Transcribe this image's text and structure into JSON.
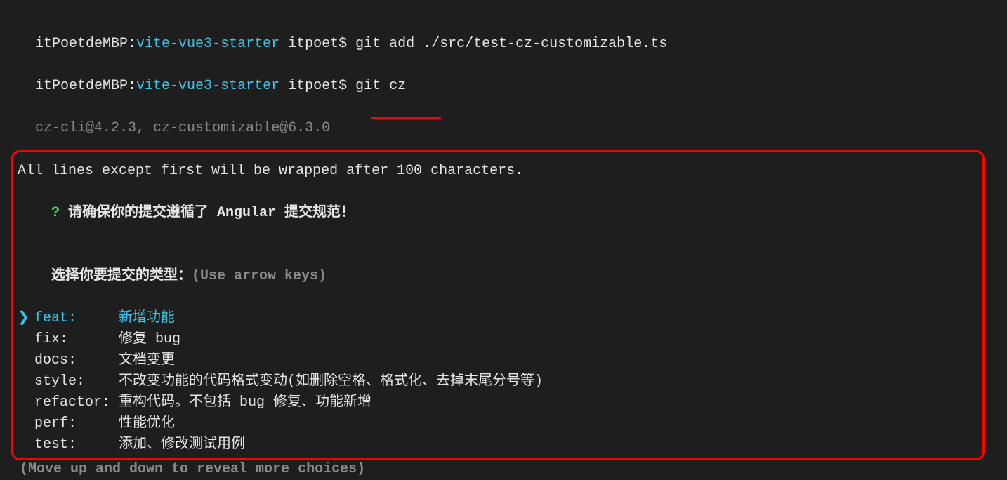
{
  "prompt1": {
    "host": "itPoetdeMBP:",
    "path": "vite-vue3-starter",
    "user": " itpoet$ ",
    "cmd": "git add ./src/test-cz-customizable.ts"
  },
  "prompt2": {
    "host": "itPoetdeMBP:",
    "path": "vite-vue3-starter",
    "user": " itpoet$ ",
    "cmd": "git cz"
  },
  "versionLine": "cz-cli@4.2.3, cz-customizable@6.3.0",
  "wrapLine": "All lines except first will be wrapped after 100 characters.",
  "questionMark": "?",
  "questionText": " 请确保你的提交遵循了 Angular 提交规范！",
  "selectPrompt": "选择你要提交的类型：",
  "useArrowKeys": "(Use arrow keys)",
  "pointer": "❯",
  "choices": [
    {
      "type": "feat:",
      "desc": "新增功能",
      "selected": true
    },
    {
      "type": "fix:",
      "desc": "修复 bug",
      "selected": false
    },
    {
      "type": "docs:",
      "desc": "文档变更",
      "selected": false
    },
    {
      "type": "style:",
      "desc": "不改变功能的代码格式变动(如删除空格、格式化、去掉末尾分号等)",
      "selected": false
    },
    {
      "type": "refactor:",
      "desc": "重构代码。不包括 bug 修复、功能新增",
      "selected": false
    },
    {
      "type": "perf:",
      "desc": "性能优化",
      "selected": false
    },
    {
      "type": "test:",
      "desc": "添加、修改测试用例",
      "selected": false
    }
  ],
  "moveHint": "(Move up and down to reveal more choices)"
}
